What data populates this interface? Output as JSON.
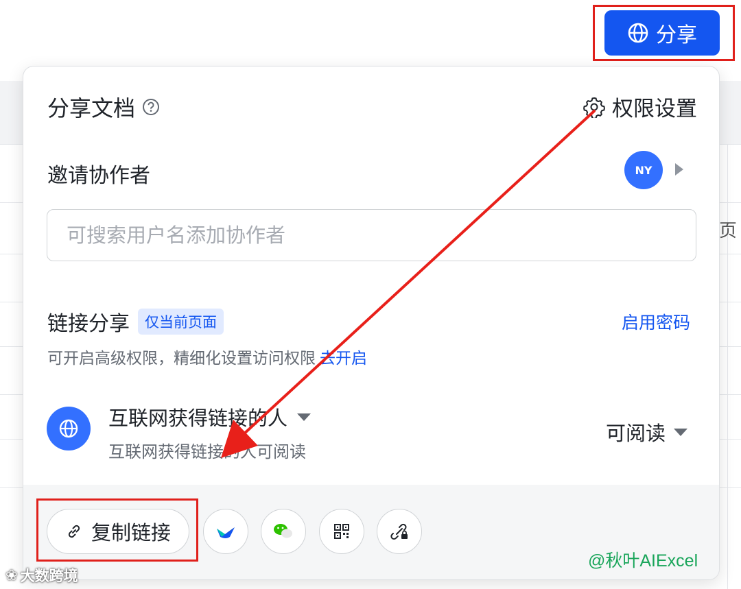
{
  "header": {
    "share_label": "分享"
  },
  "panel": {
    "title": "分享文档",
    "permission_settings": "权限设置",
    "invite_label": "邀请协作者",
    "avatar_initials": "NY",
    "search_placeholder": "可搜索用户名添加协作者",
    "link_share_label": "链接分享",
    "link_share_tag": "仅当前页面",
    "enable_password": "启用密码",
    "advanced_text": "可开启高级权限，精细化设置访问权限",
    "advanced_link": "去开启",
    "scope_title": "互联网获得链接的人",
    "scope_subtitle": "互联网获得链接的人可阅读",
    "permission_level": "可阅读",
    "copy_link": "复制链接",
    "share_targets": [
      "lark-icon",
      "wechat-icon",
      "qrcode-icon",
      "link-lock-icon"
    ]
  },
  "background": {
    "cut_glyph": "页"
  },
  "watermarks": {
    "right": "@秋叶AIExcel",
    "left": "大数跨境"
  },
  "colors": {
    "primary": "#1456f0",
    "avatar": "#3370ff",
    "highlight": "#e0201b",
    "watermark": "#19a55a"
  }
}
